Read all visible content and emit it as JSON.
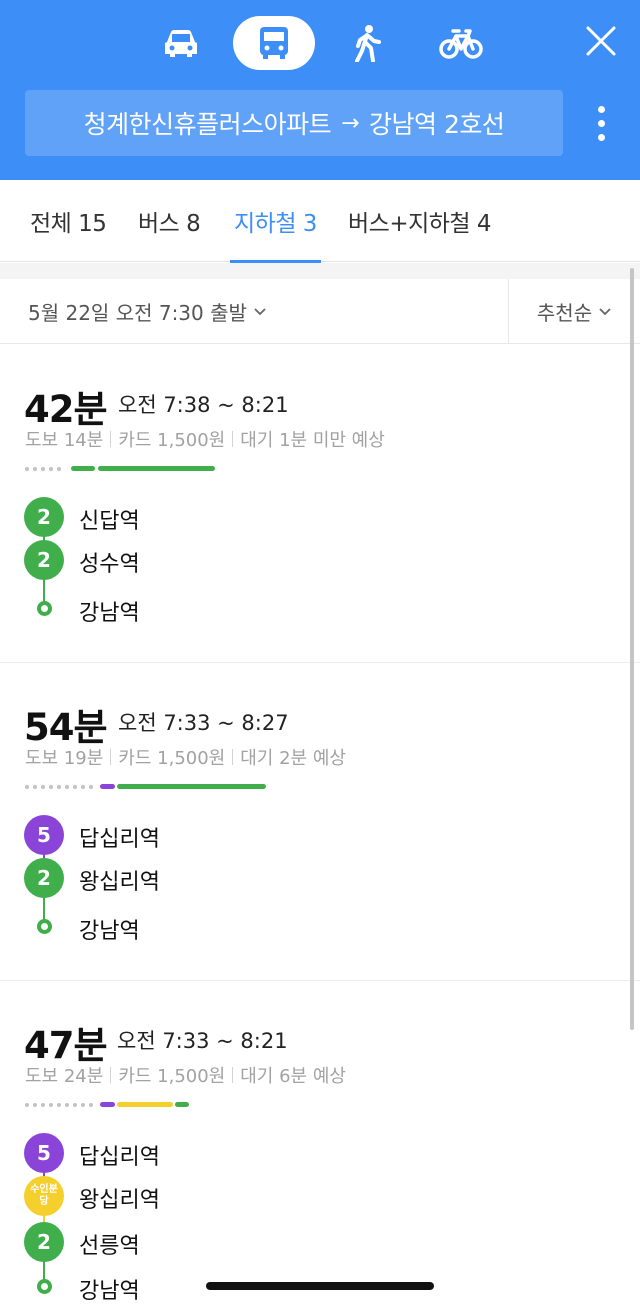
{
  "colors": {
    "header": "#3d8ef7",
    "line2": "#3fae4b",
    "line5": "#8b44d8",
    "suin": "#f5cf2b"
  },
  "modes": {
    "car": "car-icon",
    "bus": "bus-icon",
    "walk": "walk-icon",
    "bike": "bike-icon",
    "active": "bus"
  },
  "route": {
    "origin": "청계한신휴플러스아파트",
    "arrow": "→",
    "destination": "강남역 2호선"
  },
  "tabs": [
    {
      "label": "전체 15"
    },
    {
      "label": "버스 8"
    },
    {
      "label": "지하철 3",
      "active": true
    },
    {
      "label": "버스+지하철 4"
    }
  ],
  "filters": {
    "departure": "5월 22일 오전 7:30 출발",
    "sort": "추천순"
  },
  "routes": [
    {
      "duration": "42분",
      "time_range": "오전 7:38 ~ 8:21",
      "walk": "도보 14분",
      "fare": "카드 1,500원",
      "wait": "대기 1분 미만 예상",
      "stops": [
        {
          "line": "2",
          "name": "신답역"
        },
        {
          "line": "2",
          "name": "성수역"
        },
        {
          "line": "end",
          "name": "강남역"
        }
      ]
    },
    {
      "duration": "54분",
      "time_range": "오전 7:33 ~ 8:27",
      "walk": "도보 19분",
      "fare": "카드 1,500원",
      "wait": "대기 2분 예상",
      "stops": [
        {
          "line": "5",
          "name": "답십리역"
        },
        {
          "line": "2",
          "name": "왕십리역"
        },
        {
          "line": "end",
          "name": "강남역"
        }
      ]
    },
    {
      "duration": "47분",
      "time_range": "오전 7:33 ~ 8:21",
      "walk": "도보 24분",
      "fare": "카드 1,500원",
      "wait": "대기 6분 예상",
      "stops": [
        {
          "line": "5",
          "name": "답십리역"
        },
        {
          "line": "수인분당",
          "name": "왕십리역"
        },
        {
          "line": "2",
          "name": "선릉역"
        },
        {
          "line": "end",
          "name": "강남역"
        }
      ]
    }
  ]
}
